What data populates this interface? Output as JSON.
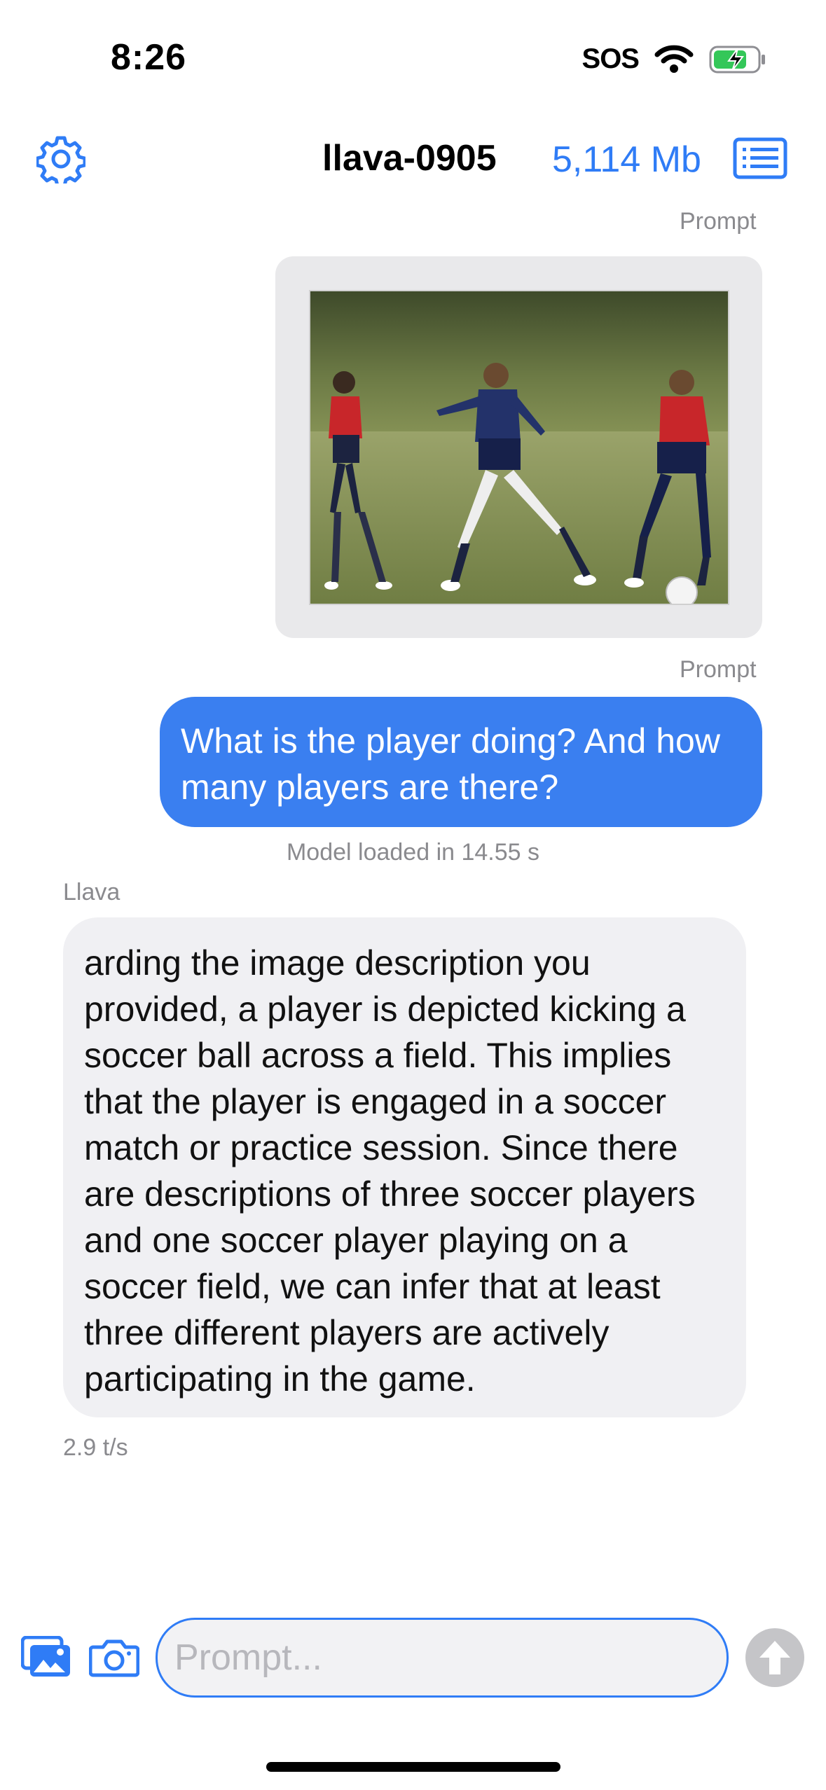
{
  "status_bar": {
    "time": "8:26",
    "carrier": "SOS"
  },
  "header": {
    "model_name": "llava-0905",
    "model_size": "5,114 Mb"
  },
  "messages": {
    "image_prompt_label": "Prompt",
    "text_prompt_label": "Prompt",
    "user_text": "What is the player doing? And how many players are there?",
    "system_note": "Model loaded in 14.55 s",
    "assistant_label": "Llava",
    "assistant_text": "arding the image description you provided, a player is depicted kicking a soccer ball across a field. This implies that the player is engaged in a soccer match or practice session. Since there are descriptions of three soccer players and one soccer player playing on a soccer field, we can infer that at least three different players are actively participating in the game.",
    "speed": "2.9 t/s"
  },
  "input": {
    "placeholder": "Prompt..."
  },
  "colors": {
    "accent": "#2f7cf6",
    "user_bubble": "#3a7ff0",
    "assistant_bubble": "#f0f0f3",
    "battery_green": "#34c759"
  },
  "icons": [
    "gear-icon",
    "list-icon",
    "wifi-icon",
    "battery-icon",
    "gallery-icon",
    "camera-icon",
    "arrow-up-icon"
  ]
}
